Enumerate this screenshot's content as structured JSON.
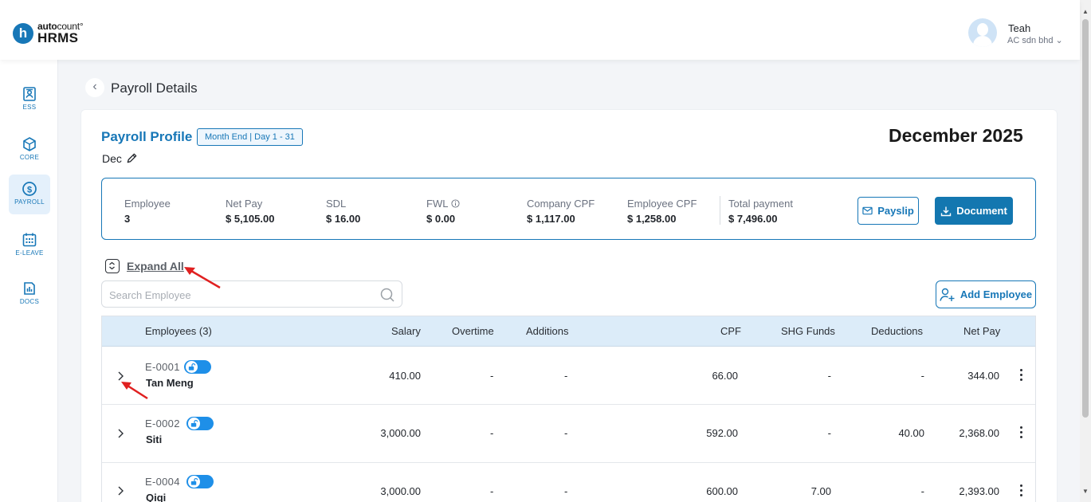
{
  "brand": {
    "letter": "h",
    "top_bold": "auto",
    "top_light": "count",
    "mark": "°",
    "bottom": "HRMS"
  },
  "user": {
    "name": "Teah",
    "company": "AC sdn bhd ⌄"
  },
  "sidebar": {
    "items": [
      {
        "label": "ESS",
        "icon": "ess-icon"
      },
      {
        "label": "CORE",
        "icon": "core-icon"
      },
      {
        "label": "PAYROLL",
        "icon": "payroll-icon",
        "active": true
      },
      {
        "label": "E-LEAVE",
        "icon": "calendar-icon"
      },
      {
        "label": "DOCS",
        "icon": "docs-icon"
      }
    ]
  },
  "page": {
    "title": "Payroll Details",
    "back_glyph": "‹"
  },
  "profile": {
    "title": "Payroll Profile",
    "badge": "Month End | Day 1 - 31",
    "period_name": "Dec",
    "month": "December 2025"
  },
  "summary": {
    "employee": {
      "label": "Employee",
      "value": "3"
    },
    "net_pay": {
      "label": "Net Pay",
      "value": "$ 5,105.00"
    },
    "sdl": {
      "label": "SDL",
      "value": "$ 16.00"
    },
    "fwl": {
      "label": "FWL",
      "value": "$ 0.00"
    },
    "company_cpf": {
      "label": "Company CPF",
      "value": "$ 1,117.00"
    },
    "employee_cpf": {
      "label": "Employee CPF",
      "value": "$ 1,258.00"
    },
    "total_payment": {
      "label": "Total payment",
      "value": "$ 7,496.00"
    },
    "payslip_label": "Payslip",
    "document_label": "Document"
  },
  "controls": {
    "expand_all": "Expand All",
    "search_placeholder": "Search Employee",
    "add_employee": "Add Employee"
  },
  "table": {
    "headers": {
      "employees": "Employees (3)",
      "salary": "Salary",
      "overtime": "Overtime",
      "additions": "Additions",
      "cpf": "CPF",
      "shg": "SHG Funds",
      "deductions": "Deductions",
      "net_pay": "Net Pay"
    },
    "rows": [
      {
        "code": "E-0001",
        "name": "Tan Meng",
        "salary": "410.00",
        "overtime": "-",
        "additions": "-",
        "cpf": "66.00",
        "shg": "-",
        "deductions": "-",
        "net_pay": "344.00"
      },
      {
        "code": "E-0002",
        "name": "Siti",
        "salary": "3,000.00",
        "overtime": "-",
        "additions": "-",
        "cpf": "592.00",
        "shg": "-",
        "deductions": "40.00",
        "net_pay": "2,368.00"
      },
      {
        "code": "E-0004",
        "name": "Qiqi",
        "salary": "3,000.00",
        "overtime": "-",
        "additions": "-",
        "cpf": "600.00",
        "shg": "7.00",
        "deductions": "-",
        "net_pay": "2,393.00"
      }
    ]
  },
  "colors": {
    "accent": "#1777b7",
    "header_row": "#dcecf9",
    "annotation": "#e02020"
  }
}
